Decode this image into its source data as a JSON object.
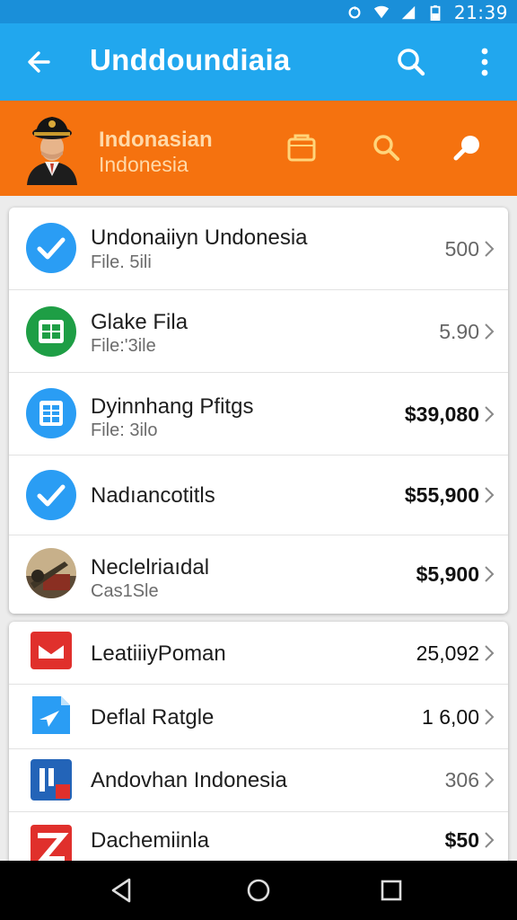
{
  "status_bar": {
    "time": "21:39"
  },
  "app_bar": {
    "title": "Unddoundiaia"
  },
  "account": {
    "name": "Indonasian",
    "subtitle": "Indonesia"
  },
  "card1": [
    {
      "label": "Undonaiiyn Undonesia",
      "sub": "File. 5ili",
      "amount": "500",
      "icon": "check-circle-icon",
      "color": "#2a9df4"
    },
    {
      "label": "Glake Fila",
      "sub": "File:'3ile",
      "amount": "5.90",
      "icon": "spreadsheet-icon",
      "color": "#1e9e45"
    },
    {
      "label": "Dyinnhang Pfitgs",
      "sub": "File: 3ilo",
      "amount": "$39,080",
      "icon": "grid-doc-icon",
      "color": "#2a9df4"
    },
    {
      "label": "Nadıancotitls",
      "sub": "",
      "amount": "$55,900",
      "icon": "check-circle-icon",
      "color": "#2a9df4"
    },
    {
      "label": "Neclelriaıdal",
      "sub": "Cas1Sle",
      "amount": "$5,900",
      "icon": "photo-avatar-icon",
      "color": "#6b5a3e"
    }
  ],
  "card2": [
    {
      "label": "LeatiiiyPoman",
      "amount": "25,092",
      "icon": "mail-app-icon",
      "color": "#e0302c"
    },
    {
      "label": "Deflal Ratgle",
      "amount": "1 6,00",
      "icon": "send-app-icon",
      "color": "#2a9df4"
    },
    {
      "label": "Andovhan Indonesia",
      "amount": "306",
      "icon": "chart-app-icon",
      "color": "#2364b8"
    },
    {
      "label": "Dachemiinla",
      "amount": "$50",
      "icon": "red-app-icon",
      "color": "#e0302c"
    }
  ],
  "nav": {
    "back": "back-icon",
    "home": "home-icon",
    "recents": "recents-icon"
  }
}
